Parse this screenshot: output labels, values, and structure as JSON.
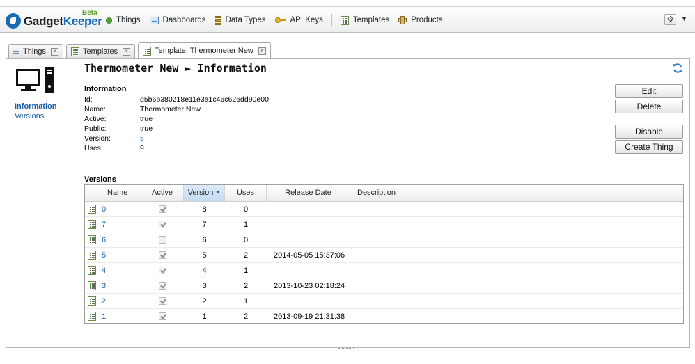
{
  "app": {
    "brand_part1": "Gadget",
    "brand_part2": "Keeper",
    "beta": "Beta",
    "accent": "#1b5fa8"
  },
  "nav": {
    "items": [
      {
        "label": "Things",
        "icon": "green-dot-icon"
      },
      {
        "label": "Dashboards",
        "icon": "dashboard-icon"
      },
      {
        "label": "Data Types",
        "icon": "data-types-icon"
      },
      {
        "label": "API Keys",
        "icon": "key-icon"
      },
      {
        "label": "Templates",
        "icon": "template-icon"
      },
      {
        "label": "Products",
        "icon": "products-icon"
      }
    ],
    "settings_icon": "gear-icon"
  },
  "tabs": [
    {
      "label": "Things",
      "active": false
    },
    {
      "label": "Templates",
      "active": false
    },
    {
      "label": "Template: Thermometer New",
      "active": true
    }
  ],
  "sidebar": {
    "links": [
      "Information",
      "Versions"
    ]
  },
  "header": {
    "title": "Thermometer New ► Information"
  },
  "info": {
    "title": "Information",
    "fields": [
      {
        "key": "Id:",
        "value": "d5b6b380218e11e3a1c46c626dd90e00"
      },
      {
        "key": "Name:",
        "value": "Thermometer New"
      },
      {
        "key": "Active:",
        "value": "true"
      },
      {
        "key": "Public:",
        "value": "true"
      },
      {
        "key": "Version:",
        "value": "5"
      },
      {
        "key": "Uses:",
        "value": "9"
      }
    ]
  },
  "actions": {
    "edit": "Edit",
    "delete": "Delete",
    "disable": "Disable",
    "create_thing": "Create Thing"
  },
  "versions": {
    "title": "Versions",
    "columns": [
      "Name",
      "Active",
      "Version",
      "Uses",
      "Release Date",
      "Description"
    ],
    "sorted_column": "Version",
    "rows": [
      {
        "name": "0",
        "active": true,
        "version": "8",
        "uses": "0",
        "release_date": "",
        "description": ""
      },
      {
        "name": "7",
        "active": true,
        "version": "7",
        "uses": "1",
        "release_date": "",
        "description": ""
      },
      {
        "name": "6",
        "active": false,
        "version": "6",
        "uses": "0",
        "release_date": "",
        "description": ""
      },
      {
        "name": "5",
        "active": true,
        "version": "5",
        "uses": "2",
        "release_date": "2014-05-05 15:37:06",
        "description": ""
      },
      {
        "name": "4",
        "active": true,
        "version": "4",
        "uses": "1",
        "release_date": "",
        "description": ""
      },
      {
        "name": "3",
        "active": true,
        "version": "3",
        "uses": "2",
        "release_date": "2013-10-23 02:18:24",
        "description": ""
      },
      {
        "name": "2",
        "active": true,
        "version": "2",
        "uses": "1",
        "release_date": "",
        "description": ""
      },
      {
        "name": "1",
        "active": true,
        "version": "1",
        "uses": "2",
        "release_date": "2013-09-19 21:31:38",
        "description": ""
      }
    ]
  }
}
